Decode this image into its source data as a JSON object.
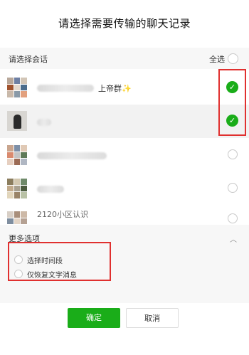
{
  "dialog": {
    "title": "请选择需要传输的聊天记录",
    "header": {
      "label": "请选择会话",
      "select_all": "全选"
    },
    "chats": [
      {
        "name_visible": "上帝群✨",
        "selected": true
      },
      {
        "name_visible": "",
        "selected": true
      },
      {
        "name_visible": "",
        "selected": false
      },
      {
        "name_visible": "",
        "selected": false
      },
      {
        "name_visible": "2120小区认识",
        "selected": false
      }
    ],
    "more_options": {
      "title": "更多选项",
      "options": [
        {
          "label": "选择时间段",
          "selected": false
        },
        {
          "label": "仅恢复文字消息",
          "selected": false
        }
      ]
    },
    "buttons": {
      "confirm": "确定",
      "cancel": "取消"
    }
  },
  "colors": {
    "accent_green": "#1aad19",
    "highlight_red": "#e0302f"
  }
}
